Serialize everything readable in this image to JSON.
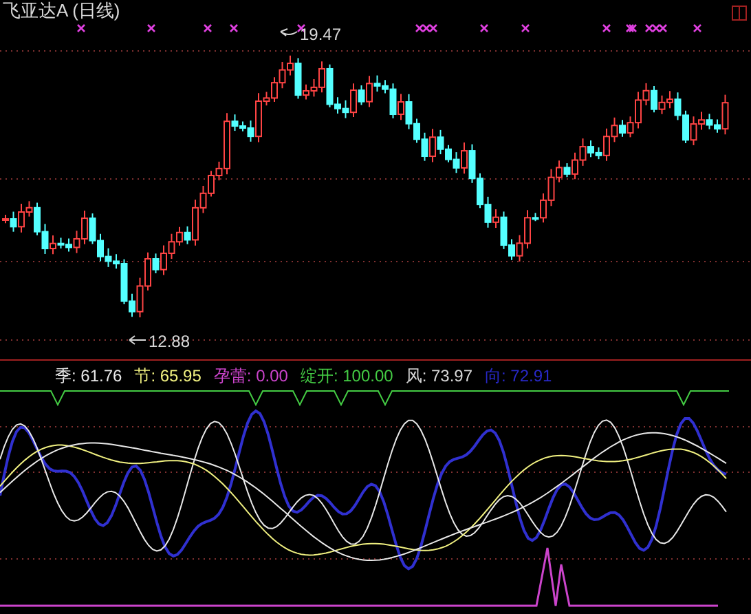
{
  "chart_title": "飞亚达A (日线)",
  "price_chart": {
    "high_label": "19.47",
    "low_label": "12.88"
  },
  "indicator": {
    "legend": [
      {
        "text": "季: 61.76",
        "color": "#e8e8e8"
      },
      {
        "text": "节: 65.95",
        "color": "#f0f080"
      },
      {
        "text": "孕蕾: 0.00",
        "color": "#cc44cc"
      },
      {
        "text": "绽开: 100.00",
        "color": "#44cc44"
      },
      {
        "text": "风: 73.97",
        "color": "#d8d8d8"
      },
      {
        "text": "向: 72.91",
        "color": "#2828c8"
      }
    ]
  }
}
